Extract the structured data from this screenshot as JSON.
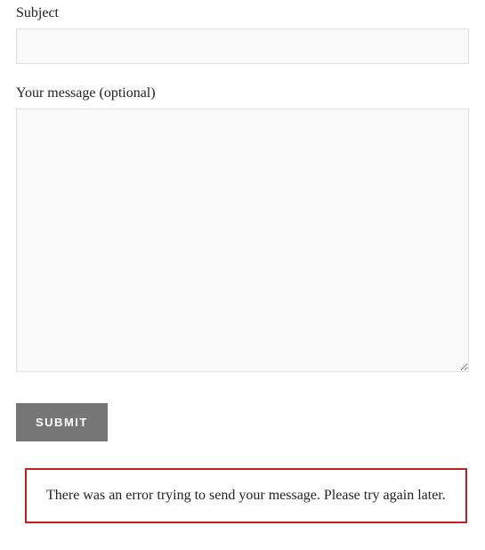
{
  "form": {
    "subject": {
      "label": "Subject",
      "value": ""
    },
    "message": {
      "label": "Your message (optional)",
      "value": ""
    },
    "submit_label": "SUBMIT"
  },
  "error": {
    "text": "There was an error trying to send your message. Please try again later."
  }
}
